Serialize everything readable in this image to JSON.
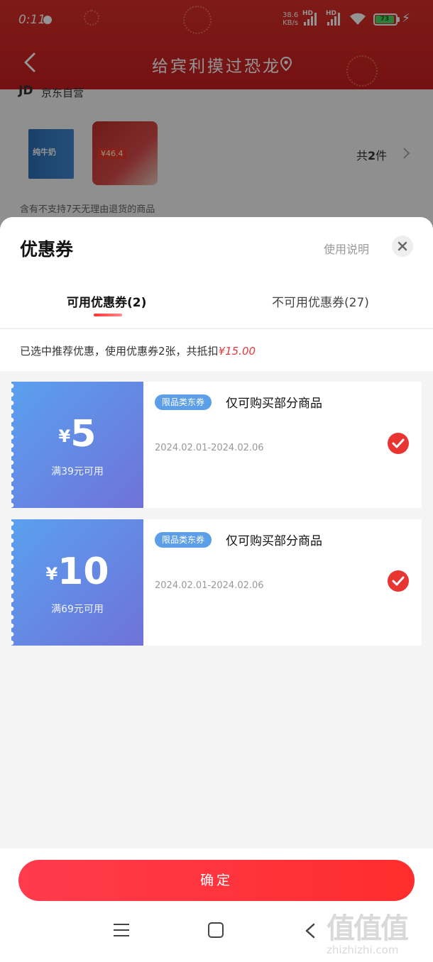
{
  "status_bar": {
    "time": "0:11",
    "speed": "38.6",
    "speed_unit": "KB/s",
    "hd1": "HD",
    "hd2": "HD",
    "battery": "73"
  },
  "header": {
    "title": "给宾利摸过恐龙"
  },
  "background_order": {
    "shop_logo": "JD",
    "shop_name": "京东自营",
    "product1_text": "纯牛奶",
    "product2_tag": "¥46.4",
    "item_count_prefix": "共",
    "item_count": "2",
    "item_count_suffix": "件",
    "no_return_notice": "含有不支持7天无理由退货的商品"
  },
  "sheet": {
    "title": "优惠券",
    "usage_link": "使用说明",
    "tabs": [
      {
        "label": "可用优惠券(2)",
        "active": true
      },
      {
        "label": "不可用优惠券(27)",
        "active": false
      }
    ],
    "summary_text": "已选中推荐优惠，使用优惠券2张，共抵扣",
    "summary_amount": "¥15.00"
  },
  "coupons": [
    {
      "symbol": "¥",
      "amount": "5",
      "condition": "满39元可用",
      "badge": "限品类东券",
      "description": "仅可购买部分商品",
      "validity": "2024.02.01-2024.02.06",
      "selected": true
    },
    {
      "symbol": "¥",
      "amount": "10",
      "condition": "满69元可用",
      "badge": "限品类东券",
      "description": "仅可购买部分商品",
      "validity": "2024.02.01-2024.02.06",
      "selected": true
    }
  ],
  "footer": {
    "confirm_label": "确定",
    "watermark_big": "值值值",
    "watermark_small": "zhizhizhi.com"
  },
  "colors": {
    "header_red": "#c81d1f",
    "accent_red": "#e93532",
    "coupon_blue": "#5aa0ef",
    "coupon_purple": "#6f72d9"
  }
}
